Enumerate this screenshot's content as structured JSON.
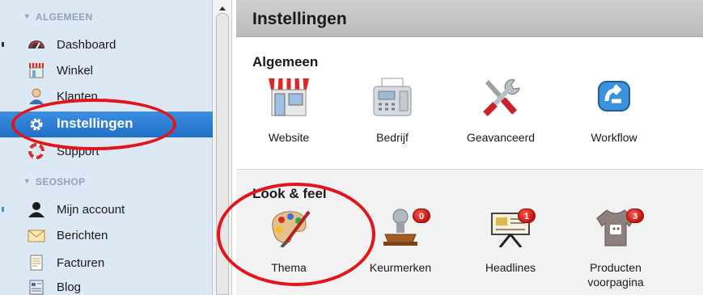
{
  "sidebar": {
    "sections": [
      {
        "title": "ALGEMEEN",
        "items": [
          {
            "label": "Dashboard",
            "icon": "dashboard-gauge-icon"
          },
          {
            "label": "Winkel",
            "icon": "shop-icon"
          },
          {
            "label": "Klanten",
            "icon": "customer-icon"
          },
          {
            "label": "Instellingen",
            "icon": "gear-icon",
            "active": true
          },
          {
            "label": "Support",
            "icon": "lifebuoy-icon"
          }
        ]
      },
      {
        "title": "SEOSHOP",
        "items": [
          {
            "label": "Mijn account",
            "icon": "user-icon"
          },
          {
            "label": "Berichten",
            "icon": "envelope-icon"
          },
          {
            "label": "Facturen",
            "icon": "invoice-icon"
          },
          {
            "label": "Blog",
            "icon": "blog-icon"
          }
        ]
      }
    ]
  },
  "main": {
    "title": "Instellingen",
    "groups": [
      {
        "title": "Algemeen",
        "tiles": [
          {
            "label": "Website",
            "icon": "storefront-icon"
          },
          {
            "label": "Bedrijf",
            "icon": "fax-machine-icon"
          },
          {
            "label": "Geavanceerd",
            "icon": "tools-icon"
          },
          {
            "label": "Workflow",
            "icon": "workflow-icon"
          }
        ]
      },
      {
        "title": "Look & feel",
        "tiles": [
          {
            "label": "Thema",
            "icon": "palette-icon"
          },
          {
            "label": "Keurmerken",
            "icon": "stamp-icon",
            "badge": "0"
          },
          {
            "label": "Headlines",
            "icon": "presentation-board-icon",
            "badge": "1"
          },
          {
            "label": "Producten",
            "label2": "voorpagina",
            "icon": "tshirt-icon",
            "badge": "3"
          }
        ]
      }
    ]
  },
  "colors": {
    "sidebar_bg": "#dce9f5",
    "active_item": "#2a7dd6",
    "annotation": "#e4141c",
    "badge": "#d0150f"
  }
}
